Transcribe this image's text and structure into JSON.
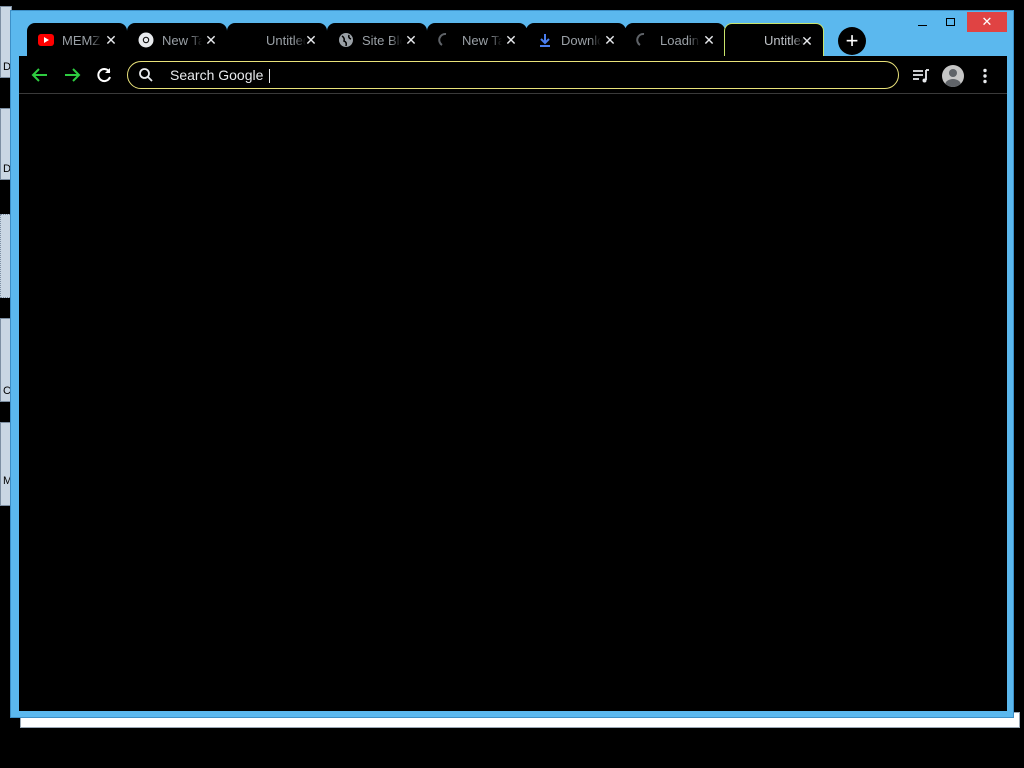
{
  "desktop": {
    "strip_labels": [
      "D",
      "D",
      "C",
      "M"
    ]
  },
  "window": {
    "controls": {
      "minimize": "–",
      "maximize": "☐",
      "close": "✕"
    }
  },
  "tabs": [
    {
      "title": "MEMZ",
      "icon": "youtube-icon"
    },
    {
      "title": "New Tab",
      "icon": "chrome-icon"
    },
    {
      "title": "Untitled",
      "icon": "blank-icon"
    },
    {
      "title": "Site Blocked",
      "icon": "globe-icon"
    },
    {
      "title": "New Tab",
      "icon": "loading-spinner-icon"
    },
    {
      "title": "Downloads",
      "icon": "download-icon"
    },
    {
      "title": "Loading",
      "icon": "loading-spinner-icon"
    },
    {
      "title": "Untitled",
      "icon": "blank-icon",
      "active": true
    }
  ],
  "toolbar": {
    "omnibox_placeholder": "Search Google",
    "colors": {
      "back": "#2ecc40",
      "forward": "#2ecc40",
      "omnibox_border": "#e9e27a",
      "active_tab_border": "#c9e46b"
    }
  }
}
